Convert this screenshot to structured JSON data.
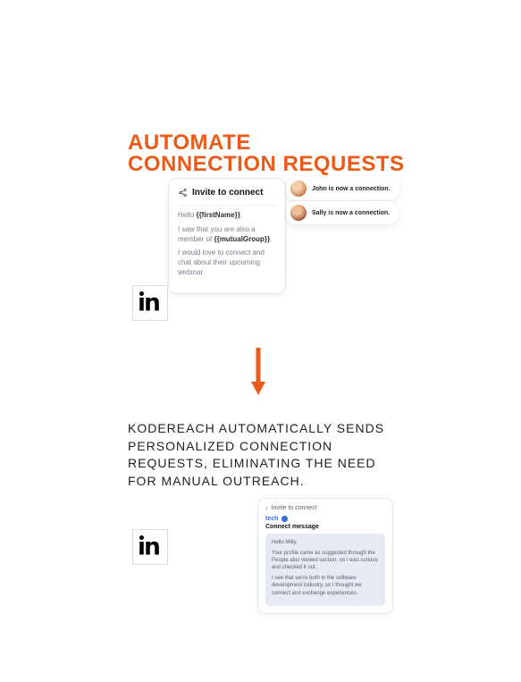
{
  "heading": {
    "line1": "AUTOMATE",
    "line2": "CONNECTION REQUESTS"
  },
  "card1": {
    "title": "Invite to connect",
    "greeting_prefix": "Hello ",
    "greeting_var": "{{firstName}}",
    "greeting_suffix": ",",
    "line2_prefix": "I saw that you are also a member of ",
    "line2_var": "{{mutualGroup}}",
    "line2_suffix": ".",
    "line3": "I would love to connect and chat about their upcoming webinar."
  },
  "notif1": {
    "text": "John is now a connection."
  },
  "notif2": {
    "text": "Sally is now a connection."
  },
  "paragraph": "KODEREACH AUTOMATICALLY SENDS PERSONALIZED CONNECTION REQUESTS, ELIMINATING THE NEED FOR MANUAL OUTREACH.",
  "card2": {
    "header": "Invite to connect",
    "tag": "tech",
    "subhead": "Connect message",
    "msg_greeting": "Hello Milly,",
    "msg_p1": "Your profile came as suggested through the People also viewed section, so I was curious and checked it out.",
    "msg_p2": "I see that we're both in the software development industry, so I thought we connect and exchange experiences."
  },
  "colors": {
    "accent": "#ea5a18",
    "link": "#2f6fe3"
  }
}
